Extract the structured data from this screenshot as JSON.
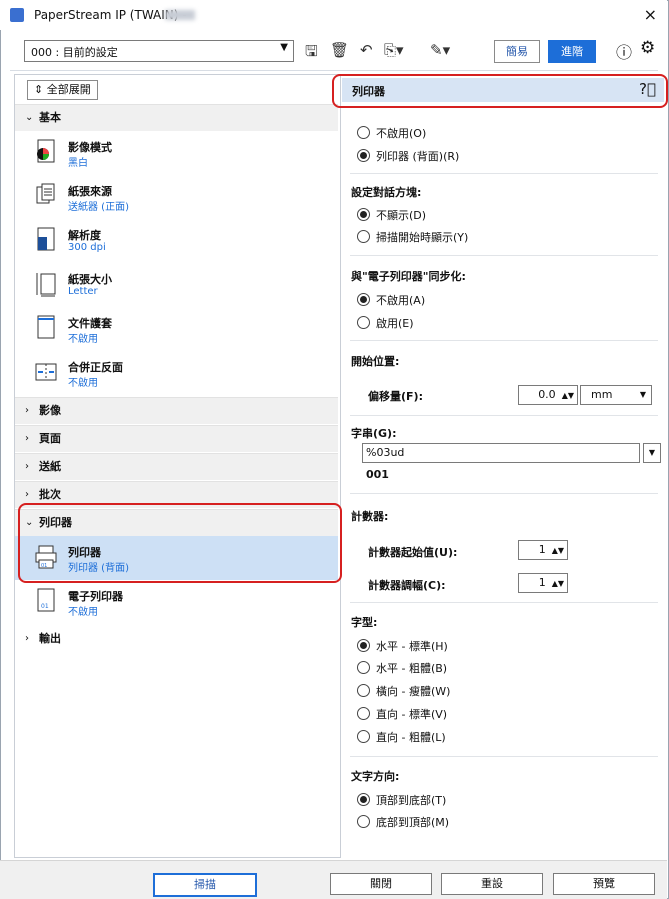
{
  "window": {
    "title": "PaperStream IP (TWAIN) -",
    "close_glyph": "×"
  },
  "toolbar": {
    "preset": "000 : 目前的設定",
    "mode_simple": "簡易",
    "mode_advanced": "進階"
  },
  "left": {
    "expand_all": "全部展開",
    "sections": {
      "basic": "基本",
      "image": "影像",
      "page": "頁面",
      "feed": "送紙",
      "batch": "批次",
      "printer": "列印器",
      "output": "輸出"
    },
    "items": [
      {
        "title": "影像模式",
        "value": "黑白"
      },
      {
        "title": "紙張來源",
        "value": "送紙器 (正面)"
      },
      {
        "title": "解析度",
        "value": "300 dpi"
      },
      {
        "title": "紙張大小",
        "value": "Letter"
      },
      {
        "title": "文件護套",
        "value": "不啟用"
      },
      {
        "title": "合併正反面",
        "value": "不啟用"
      }
    ],
    "printer_items": [
      {
        "title": "列印器",
        "value": "列印器 (背面)"
      },
      {
        "title": "電子列印器",
        "value": "不啟用"
      }
    ]
  },
  "right": {
    "header": "列印器",
    "printer_opt": [
      "不啟用(O)",
      "列印器 (背面)(R)"
    ],
    "dialog_label": "設定對話方塊:",
    "dialog_opt": [
      "不顯示(D)",
      "掃描開始時顯示(Y)"
    ],
    "sync_label": "與\"電子列印器\"同步化:",
    "sync_opt": [
      "不啟用(A)",
      "啟用(E)"
    ],
    "start_label": "開始位置:",
    "offset_label": "偏移量(F):",
    "offset_value": "0.0",
    "offset_unit": "mm",
    "string_label": "字串(G):",
    "string_value": "%03ud",
    "string_preview": "001",
    "counter_label": "計數器:",
    "counter_start_label": "計數器起始值(U):",
    "counter_start_value": "1",
    "counter_step_label": "計數器調幅(C):",
    "counter_step_value": "1",
    "font_label": "字型:",
    "font_opt": [
      "水平 - 標準(H)",
      "水平 - 粗體(B)",
      "橫向 - 瘦體(W)",
      "直向 - 標準(V)",
      "直向 - 粗體(L)"
    ],
    "direction_label": "文字方向:",
    "direction_opt": [
      "頂部到底部(T)",
      "底部到頂部(M)"
    ]
  },
  "buttons": {
    "scan": "掃描",
    "close": "關閉",
    "reset": "重設",
    "preview": "預覽"
  },
  "colors": {
    "accent": "#1d6ed8",
    "highlight": "#d62020"
  }
}
